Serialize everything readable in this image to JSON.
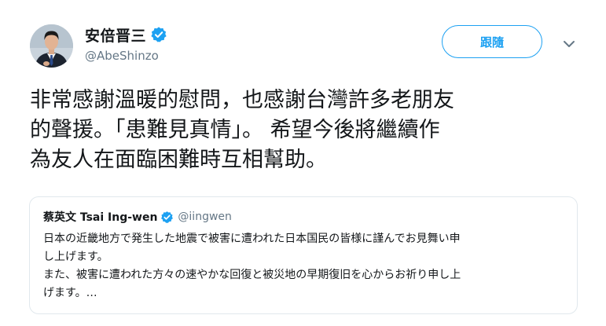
{
  "author": {
    "display_name": "安倍晋三",
    "handle": "@AbeShinzo",
    "verified": true,
    "avatar": "avatar-photo"
  },
  "actions": {
    "follow_label": "跟隨",
    "menu_icon": "chevron-down-icon"
  },
  "tweet": {
    "lines": [
      "非常感謝溫暖的慰問，也感謝台灣許多老朋友",
      "的聲援。「患難見真情」。 希望今後將繼續作",
      "為友人在面臨困難時互相幫助。"
    ]
  },
  "quoted_tweet": {
    "display_name": "蔡英文 Tsai Ing-wen",
    "handle": "@iingwen",
    "verified": true,
    "lines": [
      "日本の近畿地方で発生した地震で被害に遭われた日本国民の皆様に謹んでお見舞い申",
      "し上げます。",
      "また、被害に遭われた方々の速やかな回復と被災地の早期復旧を心からお祈り申し上",
      "げます。…"
    ]
  },
  "colors": {
    "accent": "#1da1f2",
    "text": "#14171a",
    "secondary": "#657786",
    "border": "#e1e8ed"
  }
}
